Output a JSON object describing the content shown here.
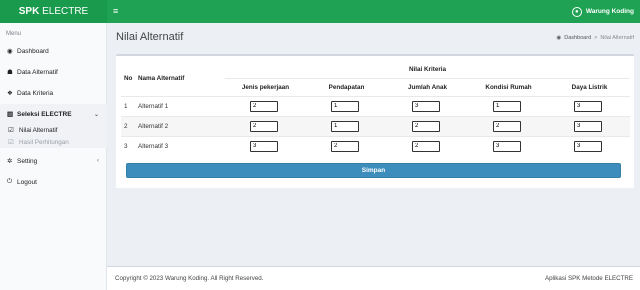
{
  "header": {
    "brand_bold": "SPK",
    "brand_rest": " ELECTRE",
    "menu_icon": "hamburger-icon",
    "user_name": "Warung Koding",
    "user_icon": "user-circle-icon"
  },
  "sidebar": {
    "menu_label": "Menu",
    "items": [
      {
        "label": "Dashboard",
        "icon": "dashboard-icon"
      },
      {
        "label": "Data Alternatif",
        "icon": "users-icon"
      },
      {
        "label": "Data Kriteria",
        "icon": "cubes-icon"
      },
      {
        "label": "Seleksi ELECTRE",
        "icon": "bar-chart-icon"
      },
      {
        "label": "Setting",
        "icon": "gear-icon"
      },
      {
        "label": "Logout",
        "icon": "power-icon"
      }
    ],
    "sub_items": [
      {
        "label": "Nilai Alternatif",
        "icon": "edit-icon"
      },
      {
        "label": "Hasil Perhitungan",
        "icon": "edit-icon"
      }
    ]
  },
  "page": {
    "title": "Nilai Alternatif",
    "breadcrumb": [
      "Dashboard",
      ">",
      "Nilai Alternatif"
    ]
  },
  "table": {
    "col_no": "No",
    "col_name": "Nama Alternatif",
    "group_header": "Nilai Kriteria",
    "criteria": [
      "Jenis pekerjaan",
      "Pendapatan",
      "Jumlah Anak",
      "Kondisi Rumah",
      "Daya Listrik"
    ],
    "rows": [
      {
        "no": "1",
        "name": "Alternatif 1",
        "values": [
          "2",
          "1",
          "3",
          "1",
          "3"
        ]
      },
      {
        "no": "2",
        "name": "Alternatif 2",
        "values": [
          "2",
          "1",
          "2",
          "2",
          "3"
        ]
      },
      {
        "no": "3",
        "name": "Alternatif 3",
        "values": [
          "3",
          "2",
          "2",
          "3",
          "3"
        ]
      }
    ]
  },
  "actions": {
    "save_label": "Simpan"
  },
  "footer": {
    "left": "Copyright © 2023 Warung Koding. All Right Reserved.",
    "right": "Aplikasi SPK Metode ELECTRE"
  },
  "colors": {
    "header_green": "#1fa254",
    "button_blue": "#3c8dbc"
  }
}
